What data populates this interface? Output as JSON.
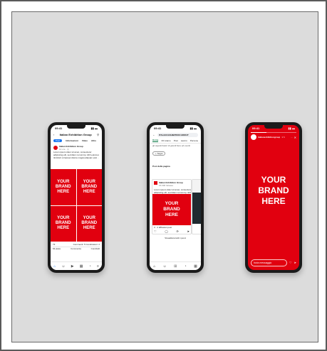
{
  "brand": {
    "accent": "#e1000f",
    "slogan_line1": "YOUR",
    "slogan_line2": "BRAND",
    "slogan_line3": "HERE"
  },
  "facebook": {
    "time": "09:41",
    "page_name": "Italian Exhibition Group",
    "tabs": [
      "Post",
      "Informazioni",
      "Video",
      "Altro"
    ],
    "post_author": "Italian Exhibition Group",
    "post_meta": "12 ore · ◎",
    "post_text_1": "Lorem ipsum dolor sit amet, consectetur",
    "post_text_2": "adipiscing elit, sed diam nonummy nibh euismod",
    "post_text_3": "tincidunt ut laoreet dolore magna aliquam erat … Altro",
    "reactions": "73",
    "comments_shares": "Commenti: 5  Condivisioni: 2",
    "actions": [
      "Mi piace",
      "Commenta",
      "Condividi"
    ],
    "nav_icons": [
      "home-icon",
      "friends-icon",
      "video-icon",
      "marketplace-icon",
      "bell-icon",
      "menu-icon"
    ]
  },
  "linkedin": {
    "time": "09:41",
    "search": "ITALIAN EXHIBITION GROUP",
    "tabs": [
      "Home",
      "Chi siamo",
      "Post",
      "Lavoro",
      "Persone"
    ],
    "about_line": "gli organizzatori di grandi fiere ed eventi",
    "follow_label": "+ Segui",
    "section_title": "Post della pagina",
    "post_author": "Italian Exhibition Group",
    "post_followers": "15.000 follower",
    "post_text_1": "Lorem ipsum dolor sit amet, consectetuer",
    "post_text_2": "adipiscing elit, sed diam nonummy nibh euismod",
    "post_text_3": "tincidunt ut laoreet dolore magna aliquam erat",
    "reactions": "3 · 2 diffusioni post",
    "see_all": "Visualizza tutti i post"
  },
  "instagram": {
    "time": "09:41",
    "account": "italianexhibitiongroup",
    "time_ago": "1 h",
    "message_placeholder": "Invia messaggio",
    "progress": 0.35
  }
}
